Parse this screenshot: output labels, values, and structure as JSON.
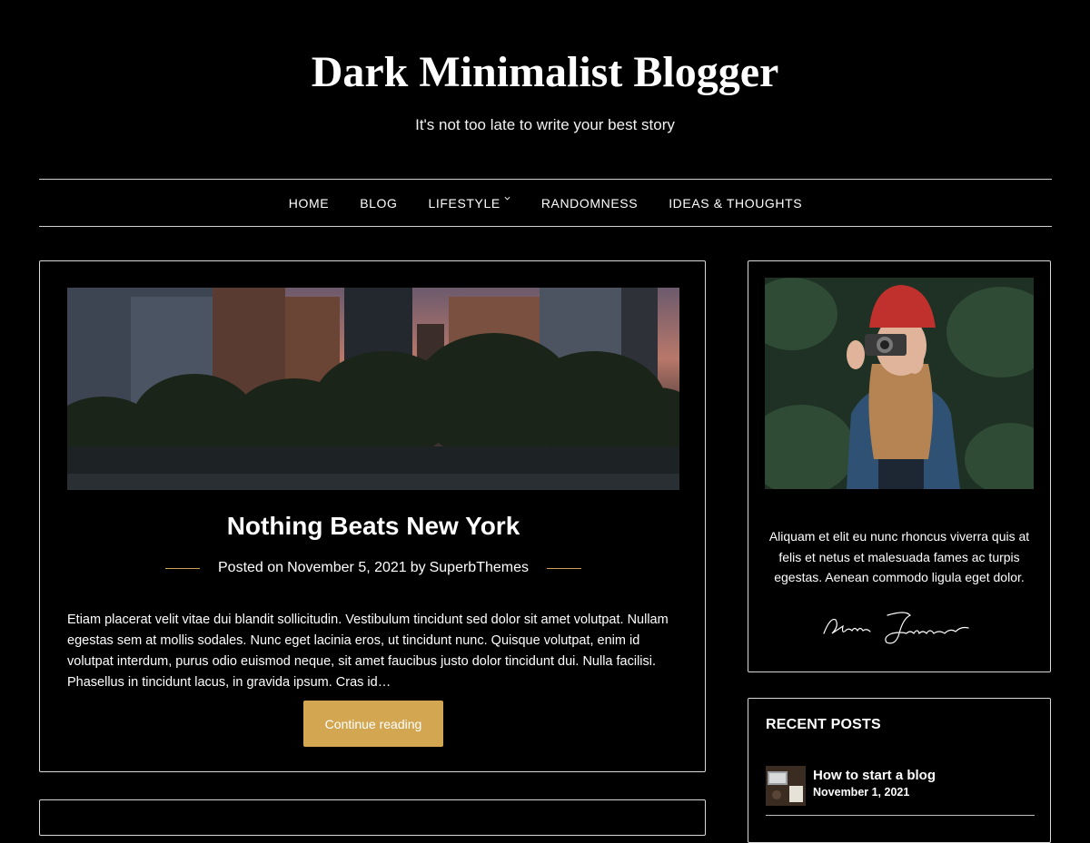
{
  "site": {
    "title": "Dark Minimalist Blogger",
    "tagline": "It's not too late to write your best story"
  },
  "nav": {
    "items": [
      {
        "label": "HOME"
      },
      {
        "label": "BLOG"
      },
      {
        "label": "LIFESTYLE",
        "has_submenu": true
      },
      {
        "label": "RANDOMNESS"
      },
      {
        "label": "IDEAS & THOUGHTS"
      }
    ]
  },
  "post": {
    "title": "Nothing Beats New York",
    "meta_prefix": "Posted on",
    "date": "November 5, 2021",
    "by": "by",
    "author": "SuperbThemes",
    "excerpt": "Etiam placerat velit vitae dui blandit sollicitudin. Vestibulum tincidunt sed dolor sit amet volutpat. Nullam egestas sem at mollis sodales. Nunc eget lacinia eros, ut tincidunt nunc. Quisque volutpat, enim id volutpat interdum, purus odio euismod neque, sit amet faucibus justo dolor tincidunt dui. Nulla facilisi. Phasellus in tincidunt lacus, in gravida ipsum. Cras id…",
    "cta_label": "Continue reading"
  },
  "sidebar": {
    "about_text": "Aliquam et elit eu nunc rhoncus viverra quis at felis et netus et malesuada fames ac turpis egestas. Aenean commodo ligula eget dolor.",
    "recent": {
      "title": "RECENT POSTS",
      "items": [
        {
          "title": "How to start a blog",
          "date": "November 1, 2021"
        }
      ]
    }
  },
  "colors": {
    "background": "#000000",
    "accent": "#d3a652",
    "text": "#ffffff",
    "border": "#d9d9d9"
  }
}
